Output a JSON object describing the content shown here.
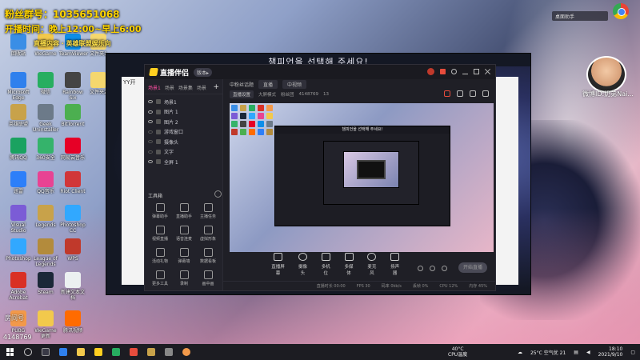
{
  "overlay": {
    "line1": "粉丝群号：",
    "line1_suffix": "1035651068",
    "line2": "开播时间：晚上12:00~早上6:00",
    "line3": "直播内容 · 英雄联盟娱乐向"
  },
  "streamer": {
    "label": "微博ID:奶弟Nai..."
  },
  "top_widget": {
    "text": "桌面助手"
  },
  "game_window": {
    "title": "챔피언을 선택해 주세요!"
  },
  "yy_window": {
    "label": "YY开"
  },
  "app": {
    "name": "直播伴侣",
    "badge": "版本▸",
    "scene_tabs": [
      "场景1",
      "场景",
      "场景集",
      "场景"
    ],
    "scenes": [
      {
        "name": "场景1",
        "visible": true
      },
      {
        "name": "图片 1",
        "visible": true
      },
      {
        "name": "图片 2",
        "visible": true
      },
      {
        "name": "游戏窗口",
        "visible": false
      },
      {
        "name": "摄像头",
        "visible": false
      },
      {
        "name": "文字",
        "visible": false
      },
      {
        "name": "全屏 1",
        "visible": true
      }
    ],
    "tools_header": "工具箱",
    "tools": [
      "弹幕助手",
      "直播助手",
      "主播任务",
      "视频直播",
      "语音连麦",
      "虚拟形象",
      "活动礼物",
      "弹幕墙",
      "数据看板",
      "更多工具",
      "录制",
      "画中画"
    ],
    "toolbar1": {
      "title": "中粉丝话题",
      "chip1": "直播",
      "chip2": "中视频"
    },
    "toolbar2": {
      "chip": "直播设置",
      "item1": "大屏模式",
      "item2": "粉丝团",
      "room_id": "4148769",
      "viewers": "13"
    },
    "preview": {
      "nested_title": "챔피언을 선택해 주세요!"
    },
    "bottom_controls": [
      "直播屏幕",
      "摄像头",
      "多机位",
      "多媒体",
      "麦克风",
      "扬声器"
    ],
    "start_button": "开始直播",
    "status": [
      "直播时长 00:00",
      "FPS 30",
      "码率 0kb/s",
      "丢帧 0%",
      "CPU 12%",
      "内存 45%"
    ]
  },
  "desktop_icons": [
    "回收站",
    "Microsoft Edge",
    "英雄联盟",
    "腾讯QQ",
    "迅雷",
    "Visual Studio",
    "Photoshop",
    "Adobe Acrobat",
    "PUBG",
    "WeGame",
    "微信",
    "Geek Uninstaller",
    "360安全",
    "QQ音乐",
    "Legends",
    "League of Legends",
    "Steam",
    "WeGame 更新",
    "TeamViewer",
    "Rainbow Six",
    "BitTorrent",
    "网易云音乐",
    "Riot Client",
    "Photoshop CC",
    "WPS",
    "新建文本文档",
    "腾讯视频",
    "文件夹1",
    "文件夹2"
  ],
  "bottom_left": {
    "mark": "房间号",
    "id": "4148769"
  },
  "tray": {
    "cpu_temp_value": "40°C",
    "cpu_temp_label": "CPU温度",
    "weather": "25°C 空气优 21",
    "time": "18:10",
    "date": "2021/9/10"
  },
  "colors": {
    "accent_pink": "#ff4fa3",
    "overlay_yellow": "#ffd400",
    "app_bg": "#1f1f26"
  }
}
